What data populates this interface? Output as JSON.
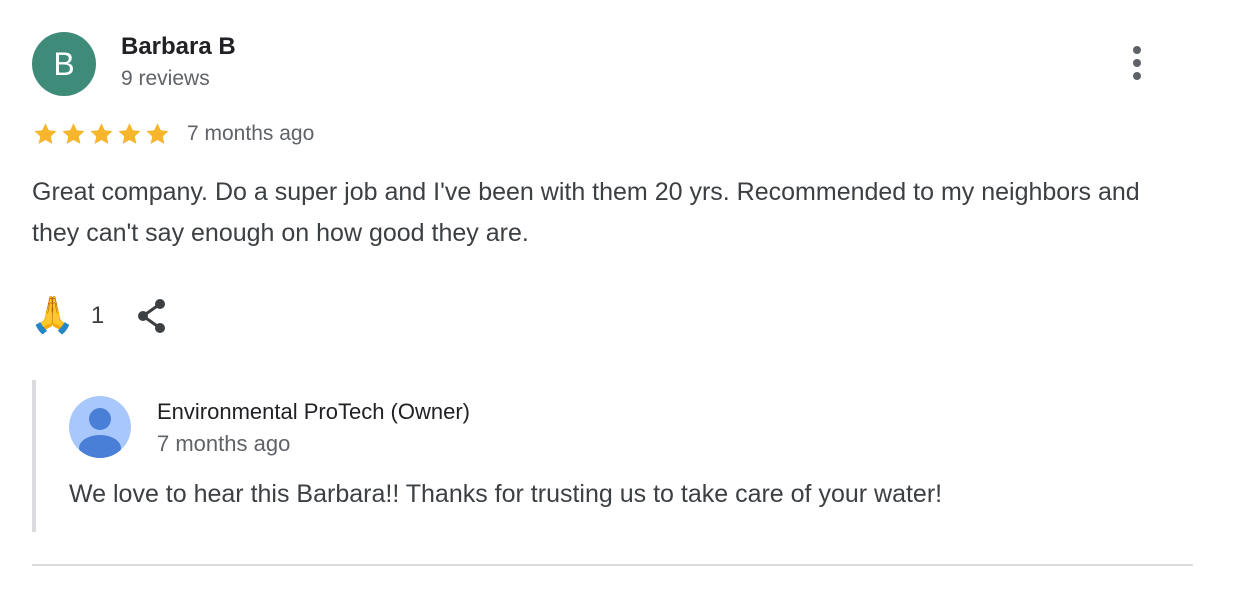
{
  "review": {
    "avatar_letter": "B",
    "author_name": "Barbara B",
    "review_count": "9 reviews",
    "rating": 5,
    "rating_max": 5,
    "date": "7 months ago",
    "text": "Great company. Do a super job and I've been with them 20 yrs. Recommended to my neighbors and they can't say enough on how good they are.",
    "more_icon": "more-vert-icon"
  },
  "actions": {
    "reaction_emoji": "🙏",
    "reaction_icon": "folded-hands-icon",
    "reaction_count": "1",
    "share_icon": "share-icon"
  },
  "owner_reply": {
    "name": "Environmental ProTech (Owner)",
    "date": "7 months ago",
    "text": "We love to hear this Barbara!! Thanks for trusting us to take care of your water!",
    "avatar_icon": "default-profile-icon"
  },
  "colors": {
    "avatar_bg": "#3e8b7a",
    "star": "#f6b52b",
    "owner_avatar_bg": "#a8c7fa",
    "owner_avatar_figure": "#4a7fd8",
    "reply_border": "#dadce0",
    "text_primary": "#202124",
    "text_secondary": "#5f6368"
  }
}
